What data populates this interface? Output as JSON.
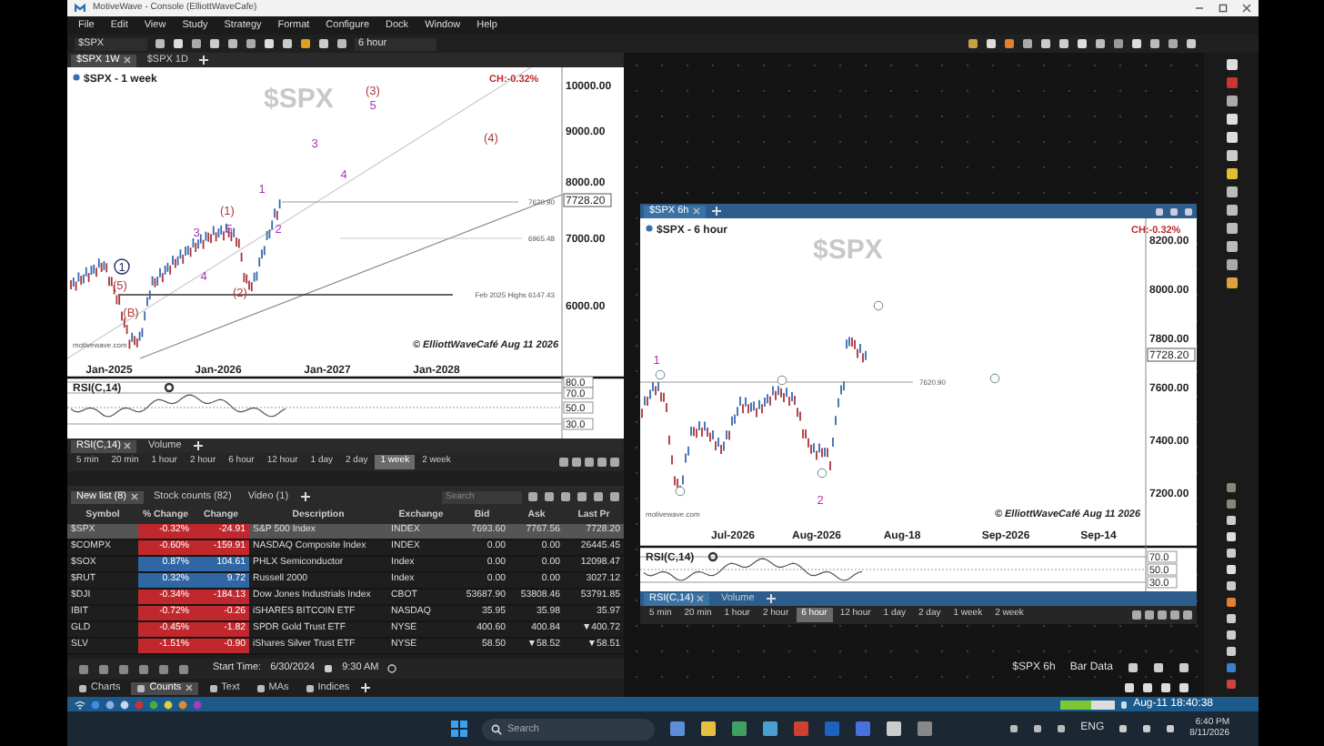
{
  "window": {
    "title": "MotiveWave - Console (ElliottWaveCafe)"
  },
  "menu": [
    "File",
    "Edit",
    "View",
    "Study",
    "Strategy",
    "Format",
    "Configure",
    "Dock",
    "Window",
    "Help"
  ],
  "toolbar": {
    "symbol": "$SPX",
    "timeframe": "6 hour"
  },
  "left_chart": {
    "tabs": [
      {
        "label": "$SPX 1W",
        "selected": true
      },
      {
        "label": "$SPX 1D",
        "selected": false
      }
    ],
    "title": "$SPX - 1 week",
    "watermark": "$SPX",
    "change": "CH:-0.32%",
    "price_labels": [
      "10000.00",
      "9000.00",
      "8000.00",
      "7000.00",
      "6000.00"
    ],
    "last_price": "7728.20",
    "date_labels": [
      "Jan-2025",
      "Jan-2026",
      "Jan-2027",
      "Jan-2028"
    ],
    "level_lines": [
      "7620.90",
      "6965.48",
      "Feb 2025 Highs  6147.43"
    ],
    "wave_labels": [
      {
        "text": "(3)",
        "color": "#b03a3a",
        "kind": "plain"
      },
      {
        "text": "5",
        "color": "#b830b8",
        "kind": "plain"
      },
      {
        "text": "3",
        "color": "#b830b8",
        "kind": "plain"
      },
      {
        "text": "4",
        "color": "#b830b8",
        "kind": "plain"
      },
      {
        "text": "(4)",
        "color": "#b03a3a",
        "kind": "plain"
      },
      {
        "text": "1",
        "color": "#b830b8",
        "kind": "plain"
      },
      {
        "text": "2",
        "color": "#b830b8",
        "kind": "plain"
      },
      {
        "text": "(1)",
        "color": "#b03a3a",
        "kind": "plain"
      },
      {
        "text": "5",
        "color": "#b830b8",
        "kind": "plain"
      },
      {
        "text": "3",
        "color": "#b830b8",
        "kind": "plain"
      },
      {
        "text": "4",
        "color": "#b830b8",
        "kind": "plain"
      },
      {
        "text": "(2)",
        "color": "#b03a3a",
        "kind": "plain"
      },
      {
        "text": "1",
        "color": "#2c2c6c",
        "kind": "circled"
      },
      {
        "text": "(5)",
        "color": "#b03a3a",
        "kind": "plain"
      },
      {
        "text": "(B)",
        "color": "#b03a3a",
        "kind": "plain"
      }
    ],
    "credit": "© ElliottWaveCafé  Aug 11 2026",
    "site": "motivewave.com",
    "rsi": {
      "title": "RSI(C,14)",
      "levels": [
        "80.0",
        "70.0",
        "50.0",
        "30.0"
      ]
    },
    "indicator_tabs": [
      {
        "label": "RSI(C,14)",
        "selected": true
      },
      {
        "label": "Volume",
        "selected": false
      }
    ],
    "timeframes": [
      {
        "label": "5 min",
        "selected": false
      },
      {
        "label": "20 min",
        "selected": false
      },
      {
        "label": "1 hour",
        "selected": false
      },
      {
        "label": "2 hour",
        "selected": false
      },
      {
        "label": "6 hour",
        "selected": false
      },
      {
        "label": "12 hour",
        "selected": false
      },
      {
        "label": "1 day",
        "selected": false
      },
      {
        "label": "2 day",
        "selected": false
      },
      {
        "label": "1 week",
        "selected": true
      },
      {
        "label": "2 week",
        "selected": false
      }
    ]
  },
  "watchlist": {
    "tabs": [
      {
        "label": "New list (8)",
        "selected": true
      },
      {
        "label": "Stock counts (82)",
        "selected": false
      },
      {
        "label": "Video (1)",
        "selected": false
      }
    ],
    "search": {
      "placeholder": "Search"
    },
    "columns": [
      "Symbol",
      "% Change",
      "Change",
      "Description",
      "Exchange",
      "Bid",
      "Ask",
      "Last Pr"
    ],
    "rows": [
      {
        "selected": true,
        "color": "#c0282d",
        "cells": [
          "$SPX",
          "-0.32%",
          "-24.91",
          "S&P 500 Index",
          "INDEX",
          "7693.60",
          "7767.56",
          "7728.20"
        ]
      },
      {
        "selected": false,
        "color": "#c0282d",
        "cells": [
          "$COMPX",
          "-0.60%",
          "-159.91",
          "NASDAQ Composite Index",
          "INDEX",
          "0.00",
          "0.00",
          "26445.45"
        ]
      },
      {
        "selected": false,
        "color": "#2f66a3",
        "cells": [
          "$SOX",
          "0.87%",
          "104.61",
          "PHLX Semiconductor",
          "Index",
          "0.00",
          "0.00",
          "12098.47"
        ]
      },
      {
        "selected": false,
        "color": "#2f66a3",
        "cells": [
          "$RUT",
          "0.32%",
          "9.72",
          "Russell 2000",
          "Index",
          "0.00",
          "0.00",
          "3027.12"
        ]
      },
      {
        "selected": false,
        "color": "#c0282d",
        "cells": [
          "$DJI",
          "-0.34%",
          "-184.13",
          "Dow Jones Industrials Index",
          "CBOT",
          "53687.90",
          "53808.46",
          "53791.85"
        ]
      },
      {
        "selected": false,
        "color": "#c0282d",
        "cells": [
          "IBIT",
          "-0.72%",
          "-0.26",
          "iSHARES BITCOIN ETF",
          "NASDAQ",
          "35.95",
          "35.98",
          "35.97"
        ]
      },
      {
        "selected": false,
        "color": "#c0282d",
        "cells": [
          "GLD",
          "-0.45%",
          "-1.82",
          "SPDR Gold Trust ETF",
          "NYSE",
          "400.60",
          "400.84",
          "▼400.72"
        ]
      },
      {
        "selected": false,
        "color": "#c0282d",
        "cells": [
          "SLV",
          "-1.51%",
          "-0.90",
          "iShares Silver Trust ETF",
          "NYSE",
          "58.50",
          "▼58.52",
          "▼58.51"
        ]
      }
    ]
  },
  "playback": {
    "start_label": "Start Time:",
    "date": "6/30/2024",
    "time": "9:30 AM"
  },
  "bottom_tabs": [
    {
      "label": "Charts",
      "selected": false
    },
    {
      "label": "Counts",
      "selected": true
    },
    {
      "label": "Text",
      "selected": false
    },
    {
      "label": "MAs",
      "selected": false
    },
    {
      "label": "Indices",
      "selected": false
    }
  ],
  "right_chart": {
    "tabs": [
      {
        "label": "$SPX 6h",
        "selected": true
      }
    ],
    "title": "$SPX - 6 hour",
    "watermark": "$SPX",
    "change": "CH:-0.32%",
    "price_labels": [
      "8200.00",
      "8000.00",
      "7800.00",
      "7600.00",
      "7400.00",
      "7200.00"
    ],
    "last_price": "7728.20",
    "date_labels": [
      "Jul-2026",
      "Aug-2026",
      "Aug-18",
      "Sep-2026",
      "Sep-14"
    ],
    "level_lines": [
      "7620.90"
    ],
    "wave_labels": [
      {
        "text": "1",
        "color": "#b830b8",
        "kind": "plain"
      },
      {
        "text": "2",
        "color": "#b830b8",
        "kind": "plain"
      }
    ],
    "credit": "© ElliottWaveCafé  Aug 11 2026",
    "site": "motivewave.com",
    "rsi": {
      "title": "RSI(C,14)",
      "levels": [
        "70.0",
        "50.0",
        "30.0"
      ]
    },
    "indicator_tabs": [
      {
        "label": "RSI(C,14)",
        "selected": true
      },
      {
        "label": "Volume",
        "selected": false
      }
    ],
    "timeframes": [
      {
        "label": "5 min",
        "selected": false
      },
      {
        "label": "20 min",
        "selected": false
      },
      {
        "label": "1 hour",
        "selected": false
      },
      {
        "label": "2 hour",
        "selected": false
      },
      {
        "label": "6 hour",
        "selected": true
      },
      {
        "label": "12 hour",
        "selected": false
      },
      {
        "label": "1 day",
        "selected": false
      },
      {
        "label": "2 day",
        "selected": false
      },
      {
        "label": "1 week",
        "selected": false
      },
      {
        "label": "2 week",
        "selected": false
      }
    ]
  },
  "bar_data": {
    "symbol": "$SPX 6h",
    "label": "Bar Data"
  },
  "status_bar": {
    "memory": {
      "level": 0.55
    },
    "clock": "Aug-11 18:40:38"
  },
  "taskbar": {
    "search": {
      "placeholder": "Search"
    },
    "language": "ENG",
    "time": "6:40 PM",
    "date": "8/11/2026"
  }
}
